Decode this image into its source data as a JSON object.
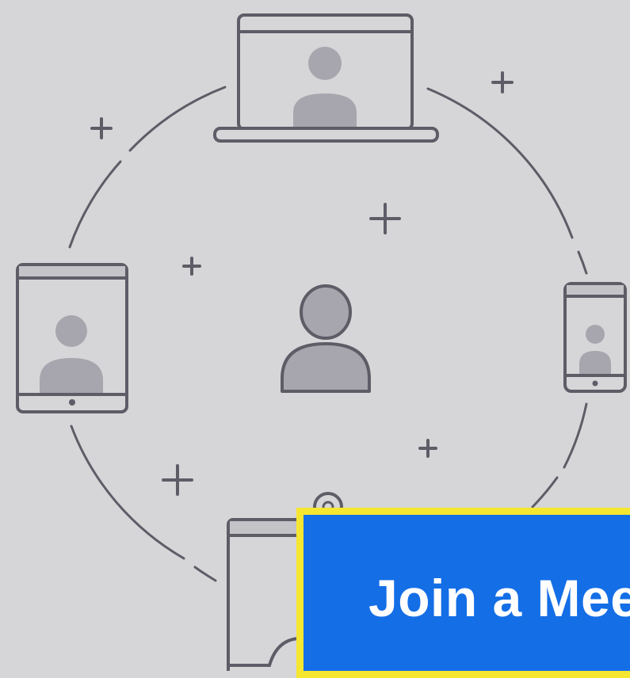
{
  "join_button": {
    "label": "Join a Meeting"
  },
  "illustration": {
    "icons": [
      "laptop-icon",
      "tablet-icon",
      "phone-icon",
      "desktop-icon",
      "user-icon",
      "plus-icon",
      "webcam-icon"
    ]
  },
  "colors": {
    "background": "#d6d6d8",
    "line": "#5e5c66",
    "avatar": "#a7a6ae",
    "screen_bar": "#c4c3c8",
    "button": "#146ee6",
    "button_border": "#f5e631",
    "button_text": "#ffffff"
  }
}
